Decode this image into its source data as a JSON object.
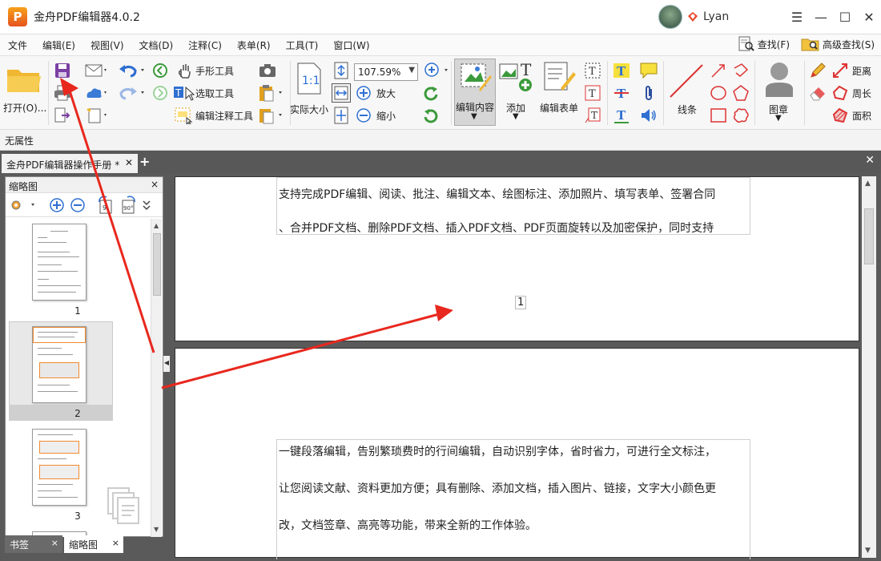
{
  "app": {
    "title": "金舟PDF编辑器4.0.2",
    "logo_letter": "P",
    "user_name": "Lyan"
  },
  "window_controls": {
    "menu": "☰",
    "minimize": "—",
    "maximize": "☐",
    "close": "✕"
  },
  "menu": {
    "items": [
      "文件",
      "编辑(E)",
      "视图(V)",
      "文档(D)",
      "注释(C)",
      "表单(R)",
      "工具(T)",
      "窗口(W)"
    ],
    "find": "查找(F)",
    "advanced_find": "高级查找(S)"
  },
  "ribbon": {
    "open": "打开(O)...",
    "hand_tool": "手形工具",
    "select_tool": "选取工具",
    "edit_annotation_tool": "编辑注释工具",
    "actual_size": "实际大小",
    "zoom_value": "107.59%",
    "zoom_in": "放大",
    "zoom_out": "缩小",
    "edit_content": "编辑内容",
    "add": "添加",
    "edit_form": "编辑表单",
    "lines": "线条",
    "stamp": "图章",
    "distance": "距离",
    "perimeter": "周长",
    "area": "面积"
  },
  "properties": {
    "label": "无属性"
  },
  "tabs": {
    "document_tab": "金舟PDF编辑器操作手册 *",
    "add": "+",
    "close": "✕"
  },
  "left_panel": {
    "title": "缩略图",
    "close": "×",
    "thumbnails": [
      {
        "page": "1"
      },
      {
        "page": "2"
      },
      {
        "page": "3"
      }
    ],
    "bottom_tabs": [
      {
        "label": "书签",
        "close": "×"
      },
      {
        "label": "缩略图",
        "close": "×"
      }
    ]
  },
  "document": {
    "page1_lines": [
      "支持完成PDF编辑、阅读、批注、编辑文本、绘图标注、添加照片、填写表单、签署合同",
      "、合并PDF文档、删除PDF文档、插入PDF文档、PDF页面旋转以及加密保护，同时支持"
    ],
    "page1_number": "1",
    "page2_lines": [
      "一键段落编辑，告别繁琐费时的行间编辑，自动识别字体，省时省力，可进行全文标注，",
      "让您阅读文献、资料更加方便；具有删除、添加文档，插入图片、链接，文字大小颜色更",
      "改，文档签章、高亮等功能，带来全新的工作体验。"
    ]
  },
  "colors": {
    "accent": "#e8452a",
    "dark_frame": "#5a5a5a",
    "ribbon_bg": "#f7f7f7"
  }
}
